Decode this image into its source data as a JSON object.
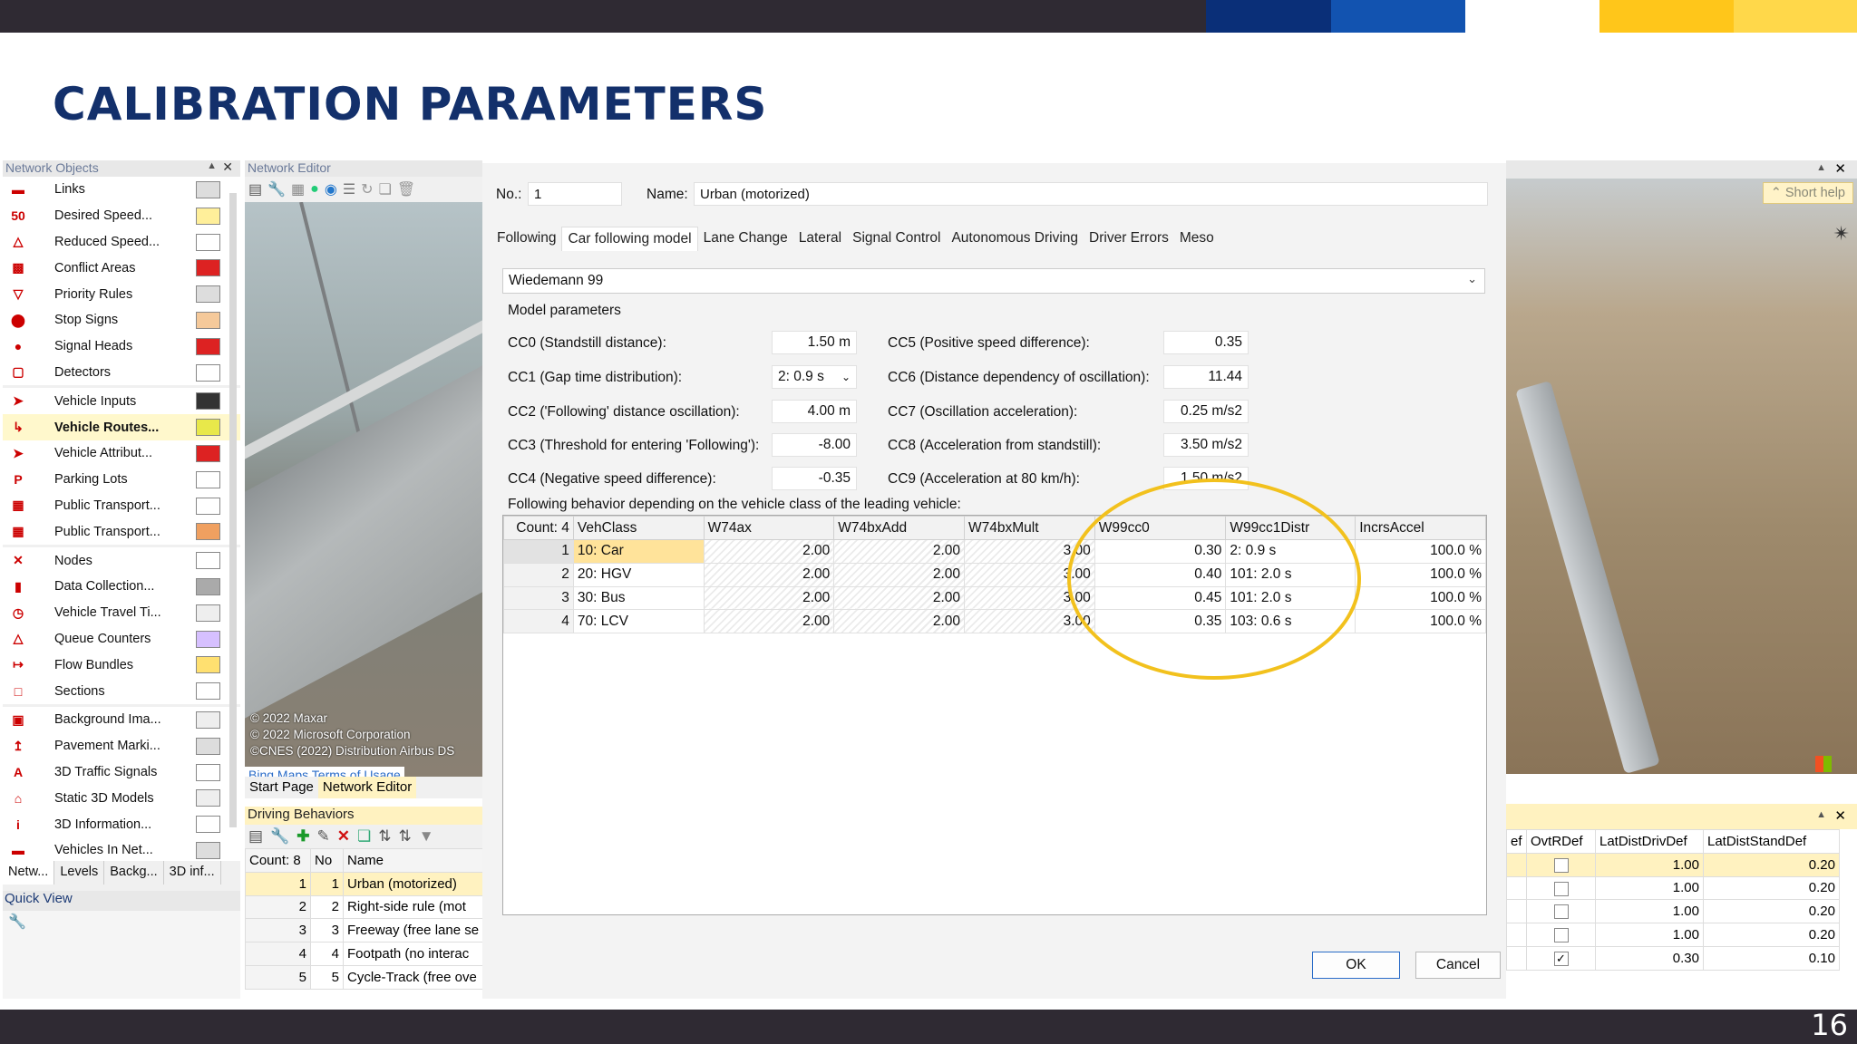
{
  "slide": {
    "title": "CALIBRATION PARAMETERS",
    "page_number": "16",
    "accent_colors": [
      "#0a2f78",
      "#1253b0",
      "#ffffff",
      "#ffc61a",
      "#ffd84a"
    ],
    "title_color": "#13306b"
  },
  "network_objects": {
    "header": "Network Objects",
    "items": [
      {
        "label": "Links",
        "icon": "links-icon"
      },
      {
        "label": "Desired Speed...",
        "icon": "speed-sign-icon"
      },
      {
        "label": "Reduced Speed...",
        "icon": "warning-triangle-icon"
      },
      {
        "label": "Conflict Areas",
        "icon": "conflict-icon"
      },
      {
        "label": "Priority Rules",
        "icon": "yield-icon"
      },
      {
        "label": "Stop Signs",
        "icon": "stop-sign-icon"
      },
      {
        "label": "Signal Heads",
        "icon": "traffic-light-icon"
      },
      {
        "label": "Detectors",
        "icon": "detector-icon"
      },
      {
        "label": "Vehicle Inputs",
        "icon": "vehicle-input-icon"
      },
      {
        "label": "Vehicle Routes...",
        "icon": "route-icon"
      },
      {
        "label": "Vehicle Attribut...",
        "icon": "vehicle-attribute-icon"
      },
      {
        "label": "Parking Lots",
        "icon": "parking-icon"
      },
      {
        "label": "Public Transport...",
        "icon": "pt-stop-icon"
      },
      {
        "label": "Public Transport...",
        "icon": "pt-line-icon"
      },
      {
        "label": "Nodes",
        "icon": "nodes-icon"
      },
      {
        "label": "Data Collection...",
        "icon": "data-collection-icon"
      },
      {
        "label": "Vehicle Travel Ti...",
        "icon": "travel-time-icon"
      },
      {
        "label": "Queue Counters",
        "icon": "queue-counter-icon"
      },
      {
        "label": "Flow Bundles",
        "icon": "flow-bundle-icon"
      },
      {
        "label": "Sections",
        "icon": "sections-icon"
      },
      {
        "label": "Background Ima...",
        "icon": "background-image-icon"
      },
      {
        "label": "Pavement Marki...",
        "icon": "pavement-marking-icon"
      },
      {
        "label": "3D Traffic Signals",
        "icon": "traffic-signal-3d-icon"
      },
      {
        "label": "Static 3D Models",
        "icon": "static-model-icon"
      },
      {
        "label": "3D Information...",
        "icon": "info-icon"
      },
      {
        "label": "Vehicles In Net...",
        "icon": "vehicles-in-net-icon"
      }
    ],
    "tabs": [
      "Netw...",
      "Levels",
      "Backg...",
      "3D inf..."
    ]
  },
  "quick_view": {
    "header": "Quick View"
  },
  "network_editor": {
    "header": "Network Editor",
    "copyright": [
      "© 2022 Maxar",
      "© 2022 Microsoft Corporation",
      "©CNES (2022) Distribution Airbus DS"
    ],
    "bing_link": "Bing Maps Terms of Usage",
    "tabs": [
      "Start Page",
      "Network Editor"
    ]
  },
  "driving_behaviors": {
    "header": "Driving Behaviors",
    "count_label": "Count: 8",
    "columns": [
      "No",
      "Name"
    ],
    "rows": [
      {
        "idx": "1",
        "no": "1",
        "name": "Urban (motorized)"
      },
      {
        "idx": "2",
        "no": "2",
        "name": "Right-side rule (mot"
      },
      {
        "idx": "3",
        "no": "3",
        "name": "Freeway (free lane se"
      },
      {
        "idx": "4",
        "no": "4",
        "name": "Footpath (no interac"
      },
      {
        "idx": "5",
        "no": "5",
        "name": "Cycle-Track (free ove"
      }
    ]
  },
  "right_panel": {
    "short_help": "Short help",
    "columns": [
      "ef",
      "OvtRDef",
      "LatDistDrivDef",
      "LatDistStandDef"
    ],
    "rows": [
      {
        "ovt": false,
        "drive": "1.00",
        "stand": "0.20"
      },
      {
        "ovt": false,
        "drive": "1.00",
        "stand": "0.20"
      },
      {
        "ovt": false,
        "drive": "1.00",
        "stand": "0.20"
      },
      {
        "ovt": false,
        "drive": "1.00",
        "stand": "0.20"
      },
      {
        "ovt": true,
        "drive": "0.30",
        "stand": "0.10"
      }
    ]
  },
  "dialog": {
    "no_label": "No.:",
    "no_value": "1",
    "name_label": "Name:",
    "name_value": "Urban (motorized)",
    "tabs": [
      "Following",
      "Car following model",
      "Lane Change",
      "Lateral",
      "Signal Control",
      "Autonomous Driving",
      "Driver Errors",
      "Meso"
    ],
    "active_tab": "Car following model",
    "model": "Wiedemann 99",
    "model_params_label": "Model parameters",
    "params_left": [
      {
        "label": "CC0 (Standstill distance):",
        "value": "1.50 m"
      },
      {
        "label": "CC1 (Gap time distribution):",
        "value": "2: 0.9 s"
      },
      {
        "label": "CC2 ('Following' distance oscillation):",
        "value": "4.00 m"
      },
      {
        "label": "CC3 (Threshold for entering 'Following'):",
        "value": "-8.00"
      },
      {
        "label": "CC4 (Negative speed difference):",
        "value": "-0.35"
      }
    ],
    "params_right": [
      {
        "label": "CC5 (Positive speed difference):",
        "value": "0.35"
      },
      {
        "label": "CC6 (Distance dependency of oscillation):",
        "value": "11.44"
      },
      {
        "label": "CC7 (Oscillation acceleration):",
        "value": "0.25 m/s2"
      },
      {
        "label": "CC8 (Acceleration from standstill):",
        "value": "3.50 m/s2"
      },
      {
        "label": "CC9 (Acceleration at 80 km/h):",
        "value": "1.50 m/s2"
      }
    ],
    "following_label": "Following behavior depending on the vehicle class of the leading vehicle:",
    "vc_count": "Count: 4",
    "vc_columns": [
      "VehClass",
      "W74ax",
      "W74bxAdd",
      "W74bxMult",
      "W99cc0",
      "W99cc1Distr",
      "IncrsAccel"
    ],
    "vc_rows": [
      {
        "idx": "1",
        "veh": "10: Car",
        "ax": "2.00",
        "add": "2.00",
        "mult": "3.00",
        "cc0": "0.30",
        "cc1": "2: 0.9 s",
        "acc": "100.0 %"
      },
      {
        "idx": "2",
        "veh": "20: HGV",
        "ax": "2.00",
        "add": "2.00",
        "mult": "3.00",
        "cc0": "0.40",
        "cc1": "101: 2.0 s",
        "acc": "100.0 %"
      },
      {
        "idx": "3",
        "veh": "30: Bus",
        "ax": "2.00",
        "add": "2.00",
        "mult": "3.00",
        "cc0": "0.45",
        "cc1": "101: 2.0 s",
        "acc": "100.0 %"
      },
      {
        "idx": "4",
        "veh": "70: LCV",
        "ax": "2.00",
        "add": "2.00",
        "mult": "3.00",
        "cc0": "0.35",
        "cc1": "103: 0.6 s",
        "acc": "100.0 %"
      }
    ],
    "ok": "OK",
    "cancel": "Cancel"
  }
}
